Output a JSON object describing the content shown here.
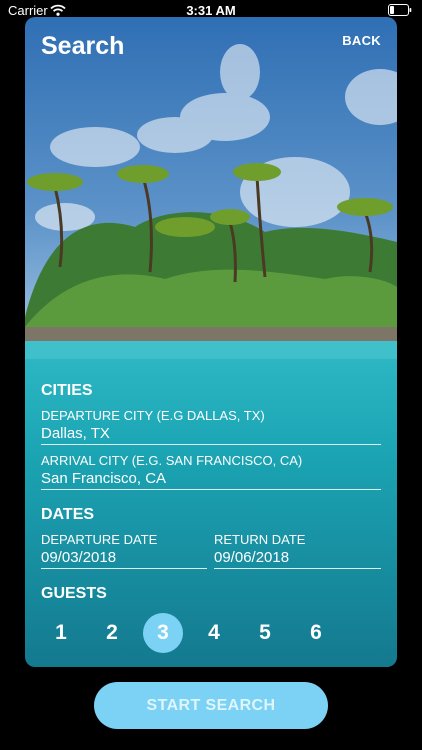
{
  "status_bar": {
    "carrier": "Carrier",
    "time": "3:31 AM"
  },
  "header": {
    "title": "Search",
    "back_label": "BACK"
  },
  "cities": {
    "heading": "CITIES",
    "departure": {
      "label": "DEPARTURE CITY (E.G DALLAS, TX)",
      "value": "Dallas, TX"
    },
    "arrival": {
      "label": "ARRIVAL CITY (E.G. SAN FRANCISCO, CA)",
      "value": "San Francisco, CA"
    }
  },
  "dates": {
    "heading": "DATES",
    "departure": {
      "label": "DEPARTURE DATE",
      "value": "09/03/2018"
    },
    "return": {
      "label": "RETURN DATE",
      "value": "09/06/2018"
    }
  },
  "guests": {
    "heading": "GUESTS",
    "options": [
      "1",
      "2",
      "3",
      "4",
      "5",
      "6"
    ],
    "selected": "3"
  },
  "start_button": "START SEARCH",
  "colors": {
    "accent": "#7cd2f4",
    "water": "#1aa2b4",
    "sky": "#3d7fbf"
  }
}
